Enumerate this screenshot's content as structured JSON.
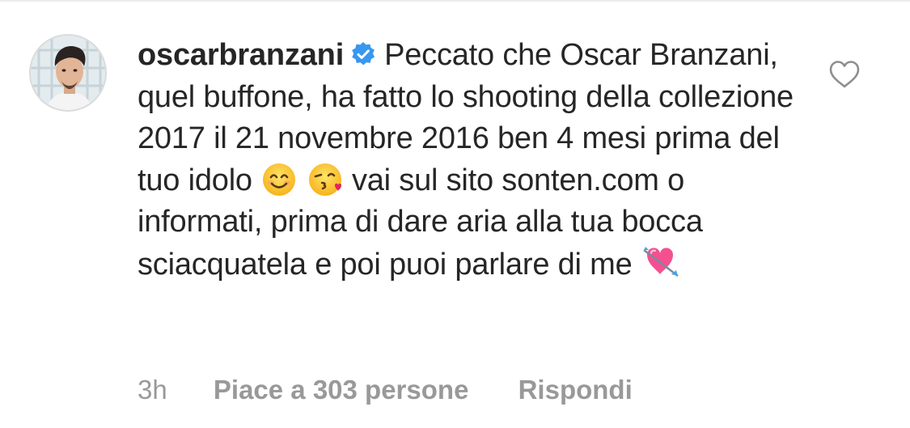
{
  "comment": {
    "username": "oscarbranzani",
    "verified_icon": "verified-badge-icon",
    "text_parts": {
      "part1": "Peccato che Oscar Branzani, quel buffone, ha fatto lo shooting della collezione 2017 il 21 novembre 2016 ben 4 mesi prima del tuo idolo",
      "part2": "vai sul sito sonten.com o informati, prima di dare aria alla tua bocca sciacquatela e poi puoi parlare di me"
    },
    "emojis": [
      "smiling-face-emoji",
      "kissing-face-emoji",
      "heart-with-arrow-emoji"
    ],
    "time": "3h",
    "likes_label": "Piace a 303 persone",
    "reply_label": "Rispondi",
    "like_icon": "heart-outline-icon"
  },
  "colors": {
    "text": "#262626",
    "meta": "#999999",
    "verified": "#3897f0"
  }
}
